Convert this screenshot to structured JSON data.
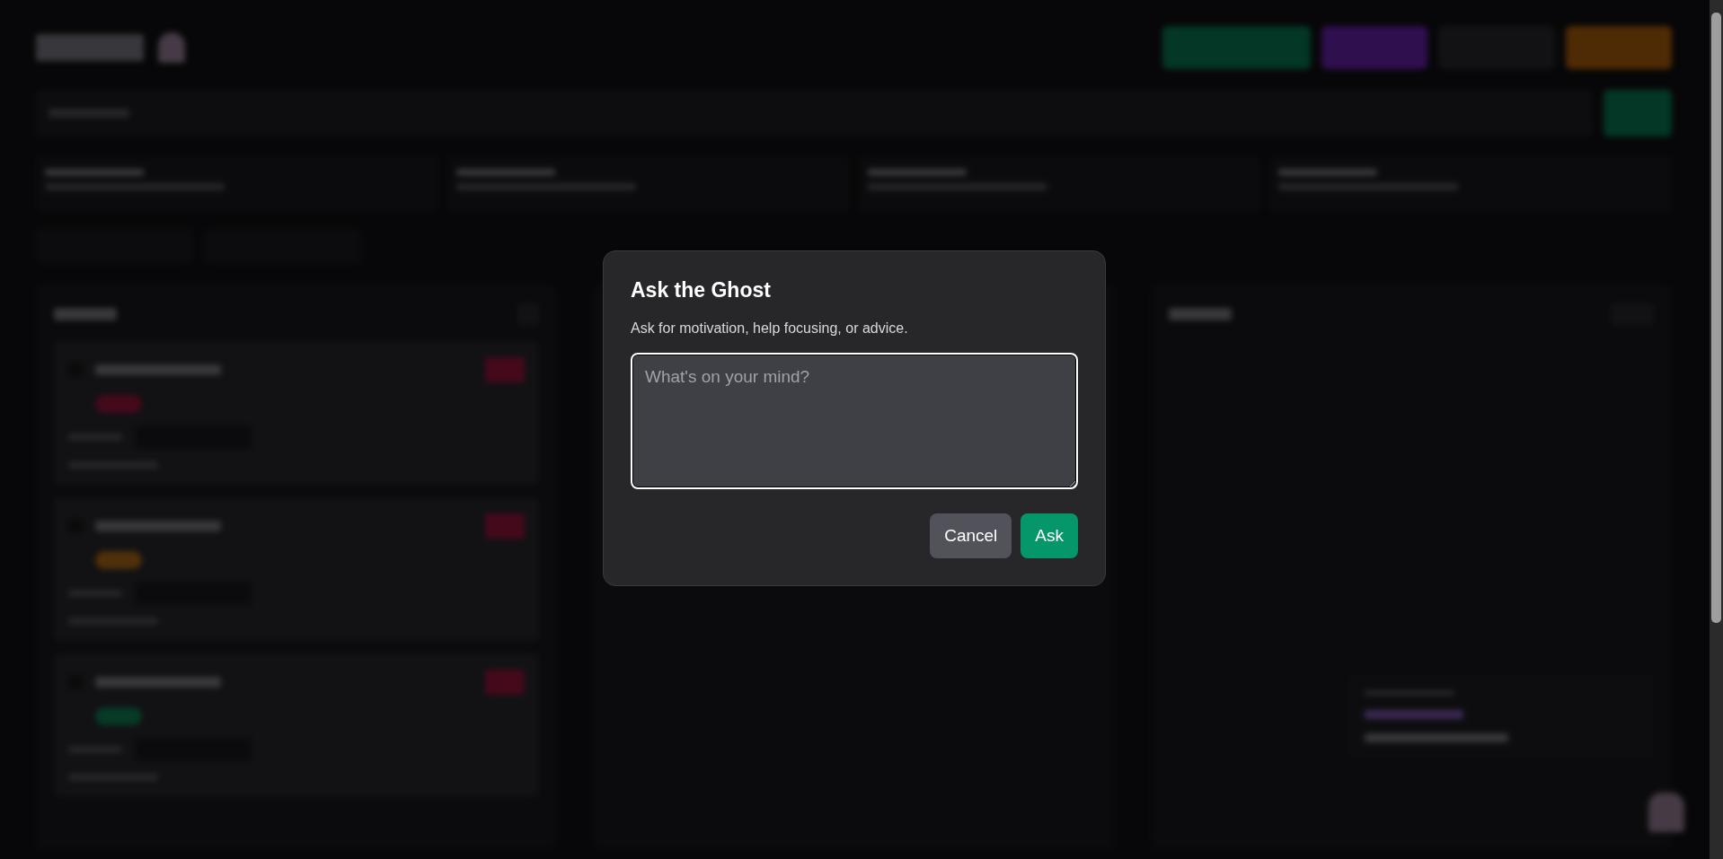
{
  "dialog": {
    "title": "Ask the Ghost",
    "description": "Ask for motivation, help focusing, or advice.",
    "question": {
      "placeholder": "What's on your mind?",
      "focused": true
    },
    "buttons": [
      {
        "label": "Cancel",
        "kind": "secondary"
      },
      {
        "label": "Ask",
        "kind": "primary"
      }
    ]
  }
}
